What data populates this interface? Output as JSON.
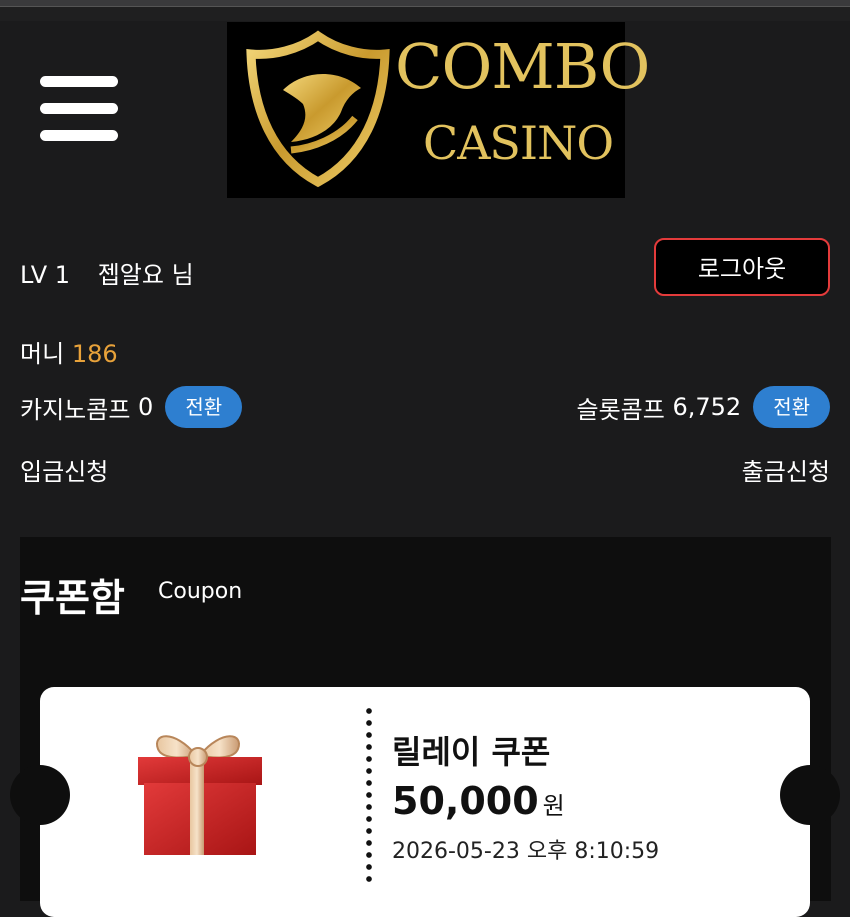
{
  "header": {
    "logo_line1": "COMBO",
    "logo_line2": "CASINO"
  },
  "user": {
    "level": "LV 1",
    "name": "젭알요 님",
    "logout_label": "로그아웃",
    "money_label": "머니",
    "money_value": "186"
  },
  "comps": {
    "casino_label": "카지노콤프",
    "casino_value": "0",
    "slot_label": "슬롯콤프",
    "slot_value": "6,752",
    "convert_label": "전환"
  },
  "actions": {
    "deposit": "입금신청",
    "withdraw": "출금신청"
  },
  "coupon": {
    "title": "쿠폰함",
    "subtitle": "Coupon",
    "items": [
      {
        "name": "릴레이 쿠폰",
        "amount": "50,000",
        "unit": "원",
        "date": "2026-05-23 오후 8:10:59"
      }
    ]
  },
  "colors": {
    "accent_gold": "#e2c25e",
    "money_orange": "#e8a23a",
    "pill_blue": "#2e7fd0",
    "logout_border": "#e43b3b"
  },
  "icons": [
    "menu-icon",
    "gift-box-icon"
  ]
}
